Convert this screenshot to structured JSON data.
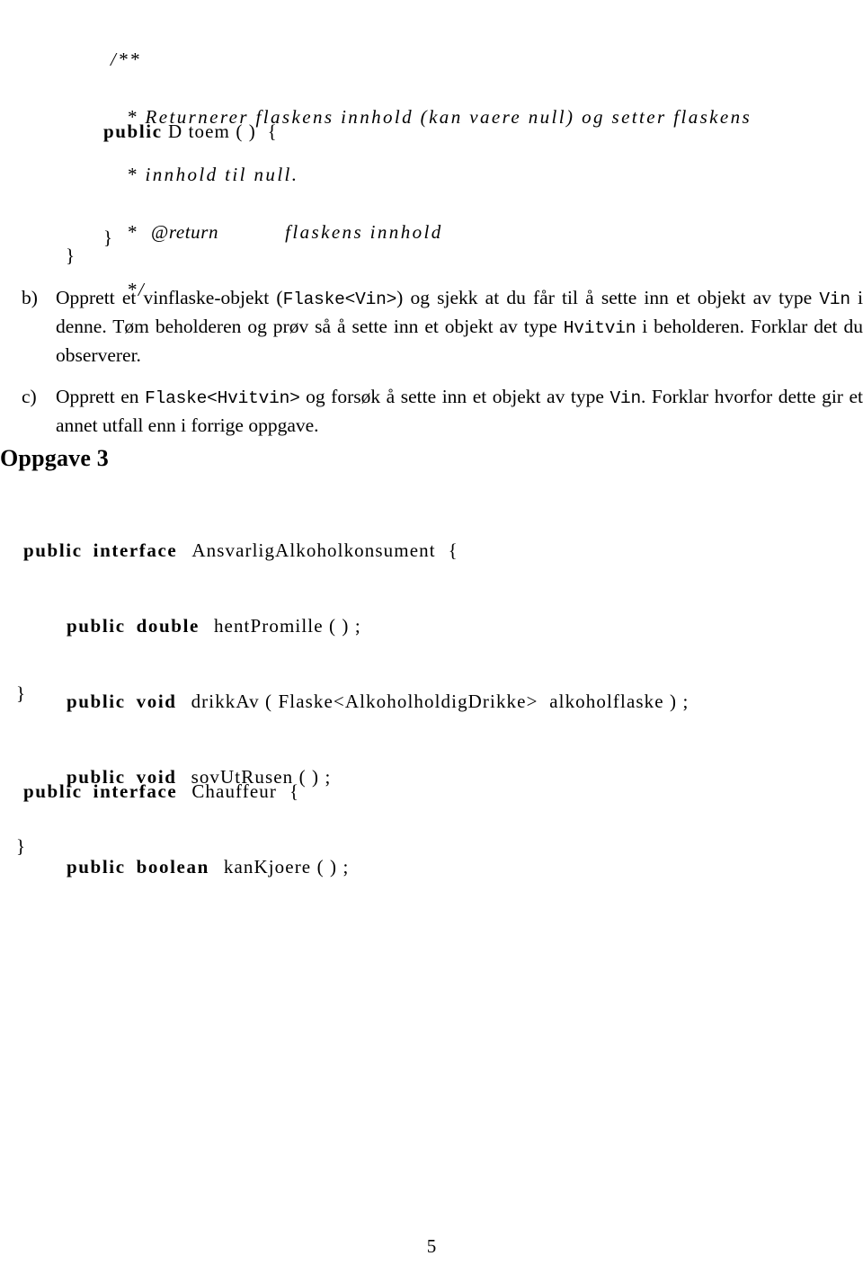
{
  "page": {
    "number": "5"
  },
  "javadoc": {
    "open": "/**",
    "lines": [
      "* Returnerer flaskens innhold (kan vaere null) og setter flaskens",
      "* innhold til null."
    ],
    "return_star": "*",
    "return_tag": "@return",
    "return_desc": "flaskens innhold",
    "close": "*/"
  },
  "method_toem": {
    "kw_public": "public",
    "signature": " D toem ( )  {"
  },
  "braces": {
    "inner": "}",
    "outer": "}"
  },
  "tasks": [
    {
      "marker": "b)",
      "seg1": "Opprett et vinflaske-objekt (",
      "code1": "Flaske<Vin>",
      "seg2": ") og sjekk at du får til å sette inn et objekt av type ",
      "code2": "Vin",
      "seg3": " i denne. Tøm beholderen og prøv så å sette inn et objekt av type ",
      "code3": "Hvitvin",
      "seg4": " i beholderen. Forklar det du observerer."
    },
    {
      "marker": "c)",
      "seg1": "Opprett en ",
      "code1": "Flaske<Hvitvin>",
      "seg2": " og forsøk å sette inn et objekt av type ",
      "code2": "Vin",
      "seg3": ". Forklar hvorfor dette gir et annet utfall enn i forrige oppgave.",
      "code3": "",
      "seg4": ""
    }
  ],
  "heading": {
    "oppgave": "Oppgave 3"
  },
  "interface_1": {
    "kw_public": "public",
    "kw_interface": "interface",
    "name": "AnsvarligAlkoholkonsument",
    "open_brace": "{",
    "methods": [
      {
        "kw_access": "public",
        "kw_type": "double",
        "signature": "hentPromille ( ) ;"
      },
      {
        "kw_access": "public",
        "kw_type": "void",
        "signature": "drikkAv ( Flaske<AlkoholholdigDrikke>  alkoholflaske ) ;"
      },
      {
        "kw_access": "public",
        "kw_type": "void",
        "signature": "sovUtRusen ( ) ;"
      }
    ],
    "close_brace": "}"
  },
  "interface_2": {
    "kw_public": "public",
    "kw_interface": "interface",
    "name": "Chauffeur",
    "open_brace": "{",
    "methods": [
      {
        "kw_access": "public",
        "kw_type": "boolean",
        "signature": "kanKjoere ( ) ;"
      }
    ],
    "close_brace": "}"
  }
}
